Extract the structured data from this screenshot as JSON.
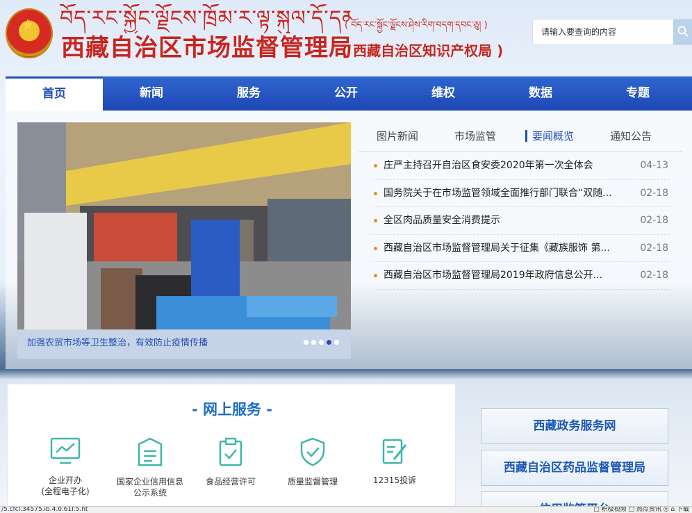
{
  "header": {
    "tibetan_title": "བོད་རང་སྐྱོང་ལྗོངས་ཁྲོམ་ར་ལྟ་སྐུལ་དོ་དམ་ཅུ།",
    "tibetan_sub": "( བོད་རང་སྐྱོང་ལྗོངས་ཤེས་རིག་བདག་དབང་ཅུ། )",
    "cn_title": "西藏自治区市场监督管理局",
    "cn_sub": "( 西藏自治区知识产权局 )"
  },
  "search": {
    "placeholder": "请输入要查询的内容"
  },
  "nav": {
    "items": [
      {
        "label": "首页"
      },
      {
        "label": "新闻"
      },
      {
        "label": "服务"
      },
      {
        "label": "公开"
      },
      {
        "label": "维权"
      },
      {
        "label": "数据"
      },
      {
        "label": "专题"
      }
    ]
  },
  "slider": {
    "caption": "加强农贸市场等卫生整治，有效防止疫情传播",
    "dot_count": 5,
    "active_dot": 3
  },
  "news_tabs": {
    "items": [
      {
        "label": "图片新闻"
      },
      {
        "label": "市场监管"
      },
      {
        "label": "要闻概览"
      },
      {
        "label": "通知公告"
      }
    ]
  },
  "news": {
    "items": [
      {
        "title": "庄严主持召开自治区食安委2020年第一次全体会",
        "date": "04-13"
      },
      {
        "title": "国务院关于在市场监管领域全面推行部门联合“双随...",
        "date": "02-18"
      },
      {
        "title": "全区肉品质量安全消费提示",
        "date": "02-18"
      },
      {
        "title": "西藏自治区市场监督管理局关于征集《藏族服饰 第...",
        "date": "02-18"
      },
      {
        "title": "西藏自治区市场监督管理局2019年政府信息公开...",
        "date": "02-18"
      }
    ]
  },
  "services": {
    "title": "- 网上服务 -",
    "items": [
      {
        "label_1": "企业开办",
        "label_2": "(全程电子化)"
      },
      {
        "label_1": "国家企业信用信息",
        "label_2": "公示系统"
      },
      {
        "label_1": "食品经营许可",
        "label_2": ""
      },
      {
        "label_1": "质量监督管理",
        "label_2": ""
      },
      {
        "label_1": "12315投诉",
        "label_2": ""
      }
    ]
  },
  "side_links": {
    "items": [
      {
        "label": "西藏政务服务网"
      },
      {
        "label": "西藏自治区药品监督管理局"
      },
      {
        "label": "信用监管平台"
      }
    ]
  },
  "status_bar": {
    "url": "/5.cfcl.34575.ib.4.0.61f.5.ht",
    "right": "□ 积极视频   □ 热点资讯   ◎   ⌂   下载"
  },
  "colors": {
    "brand_red": "#c8261f",
    "nav_blue": "#1d47b4",
    "accent_blue": "#1f4fb8",
    "service_teal": "#3fb6a8"
  }
}
